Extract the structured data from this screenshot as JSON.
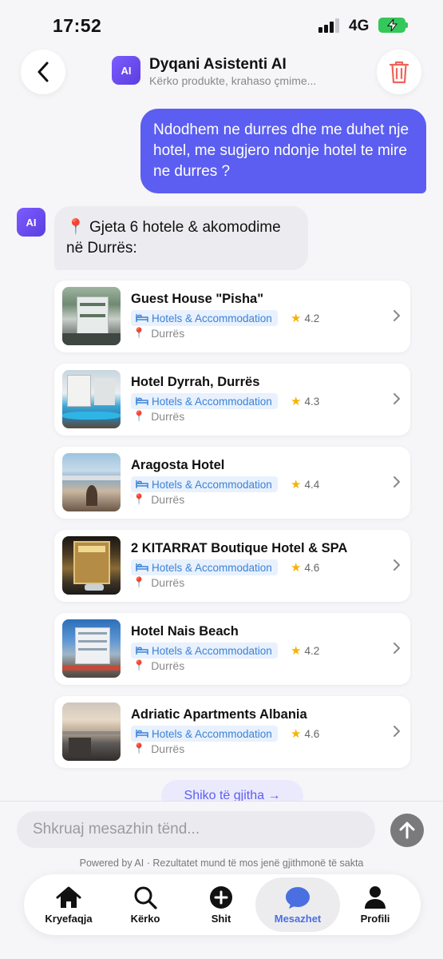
{
  "status_bar": {
    "time": "17:52",
    "network": "4G"
  },
  "header": {
    "avatar_text": "AI",
    "title": "Dyqani Asistenti AI",
    "subtitle": "Kërko produkte, krahaso çmime..."
  },
  "messages": {
    "user_text": "Ndodhem ne durres dhe me duhet nje hotel, me sugjero ndonje hotel te mire ne durres ?",
    "ai_avatar": "AI",
    "ai_text": "Gjeta 6 hotele & akomodime në Durrës:"
  },
  "hotels": [
    {
      "name": "Guest House \"Pisha\"",
      "category": "Hotels & Accommodation",
      "rating": "4.2",
      "location": "Durrës"
    },
    {
      "name": "Hotel Dyrrah, Durrës",
      "category": "Hotels & Accommodation",
      "rating": "4.3",
      "location": "Durrës"
    },
    {
      "name": "Aragosta Hotel",
      "category": "Hotels & Accommodation",
      "rating": "4.4",
      "location": "Durrës"
    },
    {
      "name": "2 KITARRAT Boutique Hotel & SPA",
      "category": "Hotels & Accommodation",
      "rating": "4.6",
      "location": "Durrës"
    },
    {
      "name": "Hotel Nais Beach",
      "category": "Hotels & Accommodation",
      "rating": "4.2",
      "location": "Durrës"
    },
    {
      "name": "Adriatic Apartments Albania",
      "category": "Hotels & Accommodation",
      "rating": "4.6",
      "location": "Durrës"
    }
  ],
  "see_all_label": "Shiko të gjitha →",
  "composer": {
    "placeholder": "Shkruaj mesazhin tënd...",
    "disclaimer": "Powered by AI · Rezultatet mund të mos jenë gjithmonë të sakta"
  },
  "tabs": [
    {
      "label": "Kryefaqja",
      "icon": "home-icon"
    },
    {
      "label": "Kërko",
      "icon": "search-icon"
    },
    {
      "label": "Shit",
      "icon": "plus-circle-icon"
    },
    {
      "label": "Mesazhet",
      "icon": "chat-bubble-icon",
      "active": true
    },
    {
      "label": "Profili",
      "icon": "person-icon"
    }
  ],
  "colors": {
    "accent": "#5b5ef0",
    "user_bubble": "#5b5ef0",
    "ai_bubble": "#ececf0",
    "category_text": "#3b82d6",
    "active_tab": "#4a6fe0",
    "delete": "#f0645a",
    "battery": "#34c759",
    "star": "#f5b400"
  }
}
